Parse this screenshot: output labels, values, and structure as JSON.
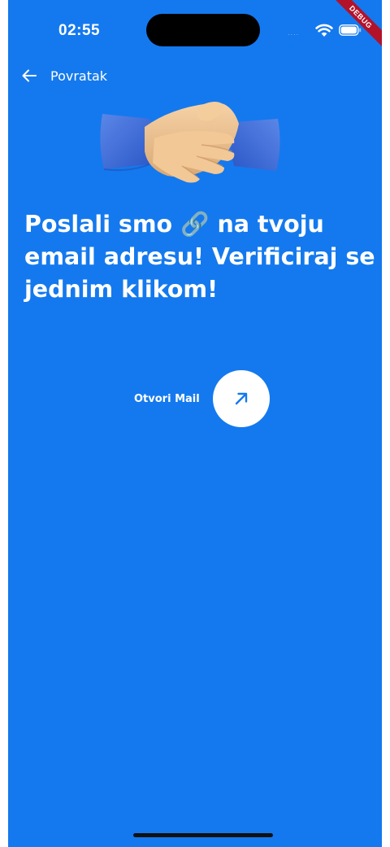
{
  "status_bar": {
    "time": "02:55",
    "signal": "....",
    "debug_label": "DEBUG"
  },
  "nav": {
    "back_label": "Povratak"
  },
  "headline": {
    "line1": "Poslali smo 🔗 na tvoju",
    "line2": "email adresu! Verificiraj se",
    "line3": "jednim klikom!"
  },
  "action": {
    "label": "Otvori Mail"
  },
  "icons": {
    "back": "arrow-left-icon",
    "open": "arrow-up-right-icon",
    "illustration": "handshake-icon"
  },
  "colors": {
    "background": "#1479ee",
    "button": "#ffffff",
    "accent": "#1479ee"
  }
}
